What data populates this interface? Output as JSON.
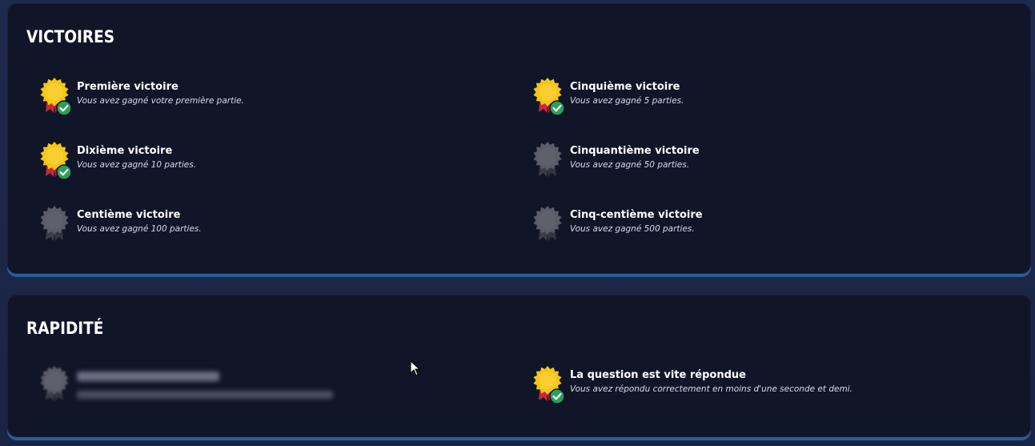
{
  "sections": [
    {
      "title": "VICTOIRES",
      "achievements": [
        {
          "name": "Première victoire",
          "desc": "Vous avez gagné votre première partie.",
          "unlocked": true
        },
        {
          "name": "Cinquième victoire",
          "desc": "Vous avez gagné 5 parties.",
          "unlocked": true
        },
        {
          "name": "Dixième victoire",
          "desc": "Vous avez gagné 10 parties.",
          "unlocked": true
        },
        {
          "name": "Cinquantième victoire",
          "desc": "Vous avez gagné 50 parties.",
          "unlocked": false
        },
        {
          "name": "Centième victoire",
          "desc": "Vous avez gagné 100 parties.",
          "unlocked": false
        },
        {
          "name": "Cinq-centième victoire",
          "desc": "Vous avez gagné 500 parties.",
          "unlocked": false
        }
      ]
    },
    {
      "title": "RAPIDITÉ",
      "achievements": [
        {
          "name": "",
          "desc": "",
          "unlocked": false,
          "hidden": true
        },
        {
          "name": "La question est vite répondue",
          "desc": "Vous avez répondu correctement en moins d'une seconde et demi.",
          "unlocked": true
        }
      ]
    }
  ],
  "icons": {
    "unlocked_badge": "gold-medal-icon",
    "locked_badge": "grey-medal-icon",
    "check": "check-icon",
    "cursor": "mouse-cursor-icon"
  },
  "colors": {
    "gold": "#f5c518",
    "ribbon": "#c8283c",
    "check": "#2e9e5b",
    "locked": "#5a5d68",
    "panel": "#111528",
    "panel_border": "#2a5d96"
  }
}
